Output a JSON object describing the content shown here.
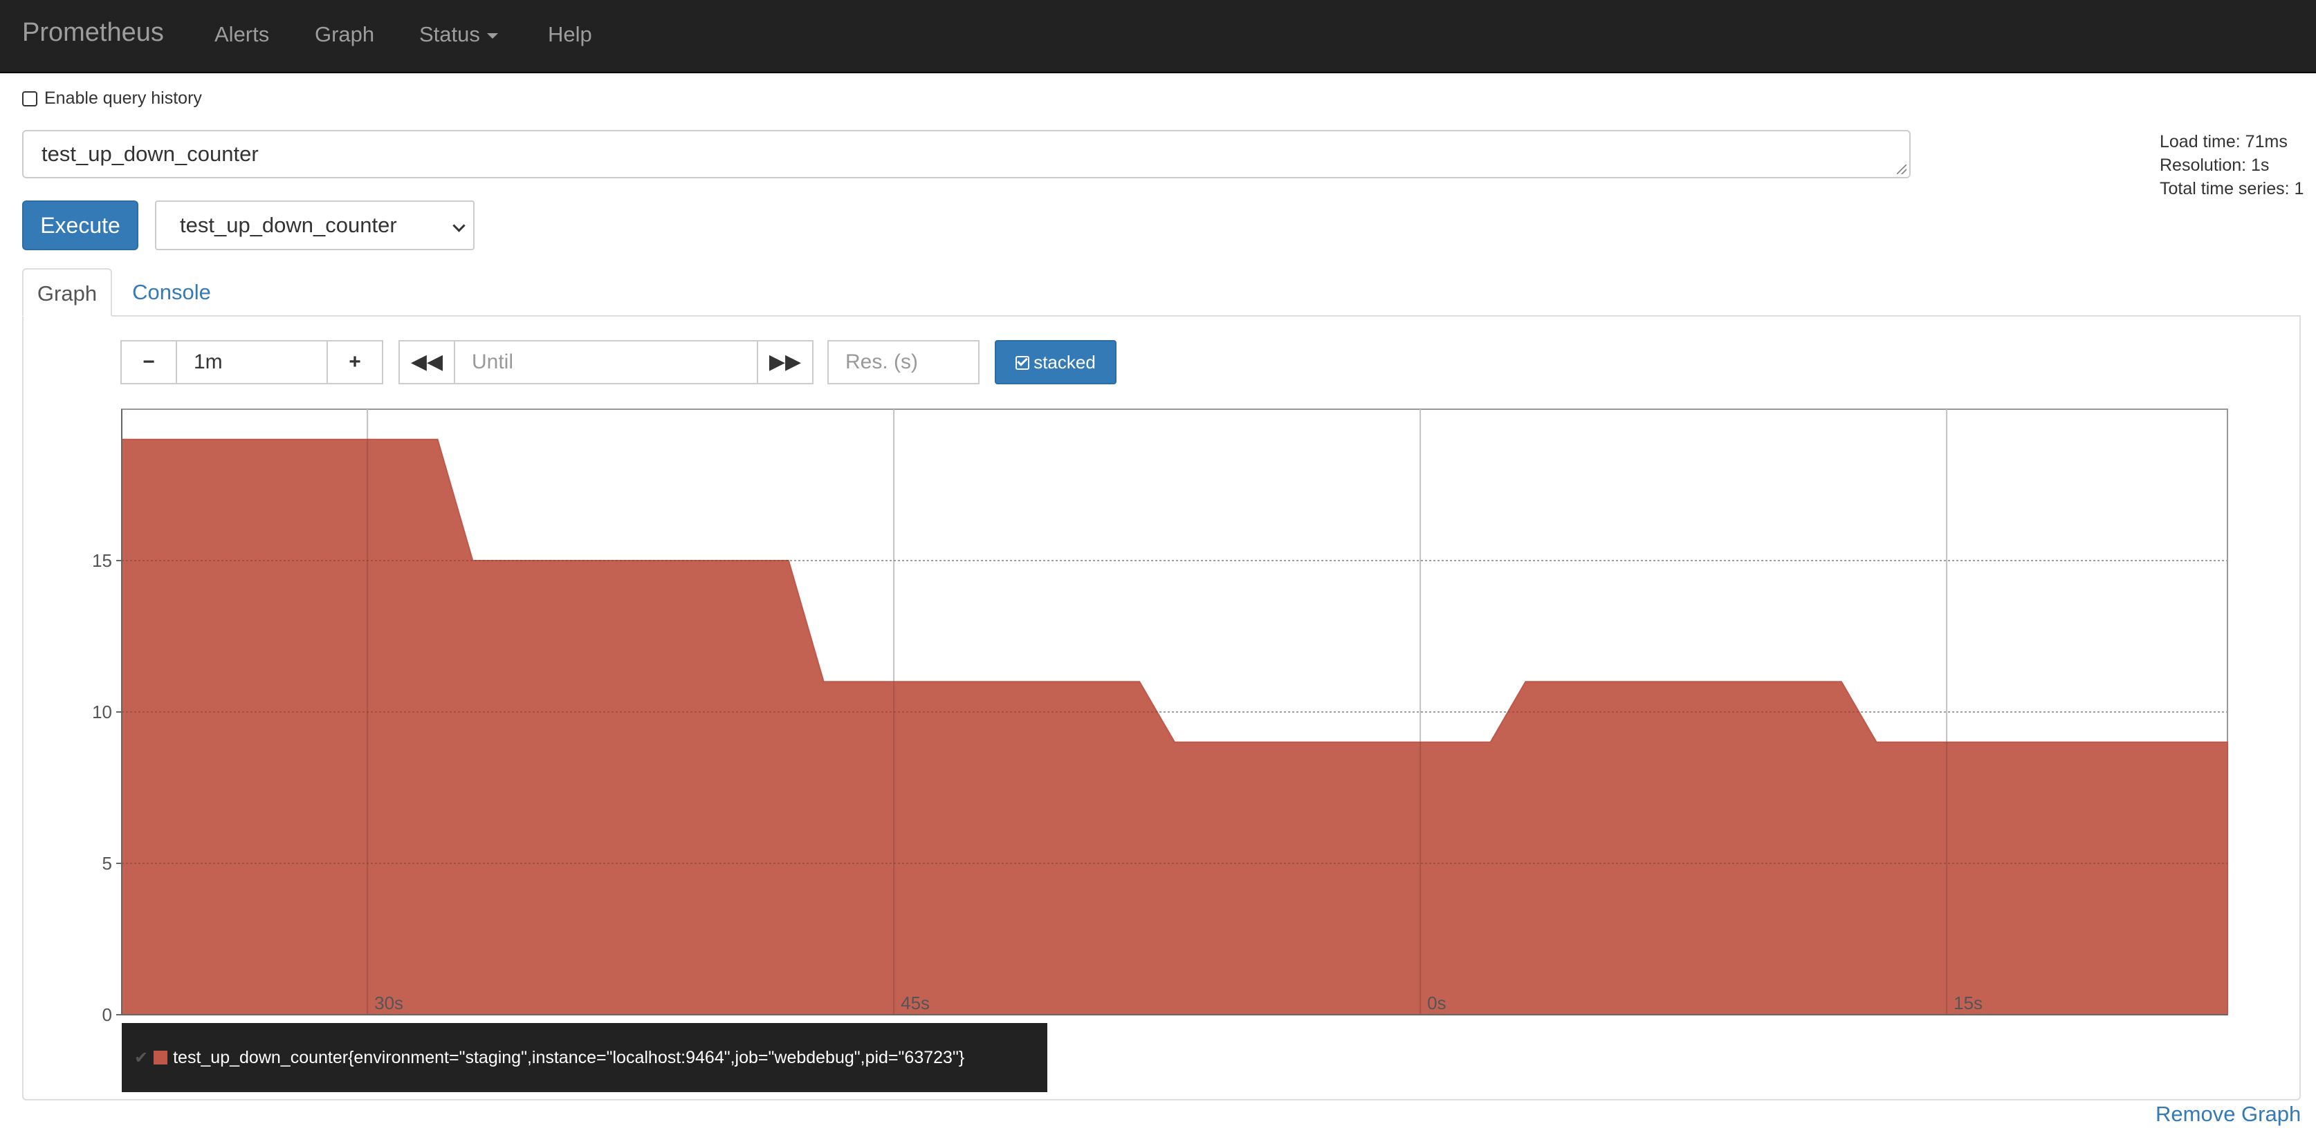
{
  "navbar": {
    "brand": "Prometheus",
    "items": [
      {
        "label": "Alerts"
      },
      {
        "label": "Graph"
      },
      {
        "label": "Status"
      },
      {
        "label": "Help"
      }
    ]
  },
  "query_history_label": "Enable query history",
  "query": {
    "expression": "test_up_down_counter"
  },
  "stats": {
    "load_time": "Load time: 71ms",
    "resolution": "Resolution: 1s",
    "total_series": "Total time series: 1"
  },
  "execute_label": "Execute",
  "metric_select": {
    "selected": "test_up_down_counter"
  },
  "tabs": [
    {
      "label": "Graph"
    },
    {
      "label": "Console"
    }
  ],
  "controls": {
    "range": "1m",
    "until_placeholder": "Until",
    "resolution_placeholder": "Res. (s)",
    "stacked_label": "stacked"
  },
  "legend": {
    "series_label": "test_up_down_counter{environment=\"staging\",instance=\"localhost:9464\",job=\"webdebug\",pid=\"63723\"}"
  },
  "remove_graph_label": "Remove Graph",
  "colors": {
    "series": "#c0584a",
    "accent": "#337ab7"
  },
  "chart_data": {
    "type": "area",
    "stacked": true,
    "x_unit": "seconds",
    "x_range": [
      23,
      83
    ],
    "x_ticks": [
      {
        "value": 30,
        "label": "30s"
      },
      {
        "value": 45,
        "label": "45s"
      },
      {
        "value": 60,
        "label": "0s"
      },
      {
        "value": 75,
        "label": "15s"
      }
    ],
    "ylim": [
      0,
      20
    ],
    "y_ticks": [
      0,
      5,
      10,
      15
    ],
    "grid": true,
    "series": [
      {
        "color": "#c0584a",
        "x": [
          23,
          32,
          33,
          42,
          43,
          52,
          53,
          62,
          63,
          72,
          73,
          83
        ],
        "values": [
          19,
          19,
          15,
          15,
          11,
          11,
          9,
          9,
          11,
          11,
          9,
          9
        ]
      }
    ]
  }
}
